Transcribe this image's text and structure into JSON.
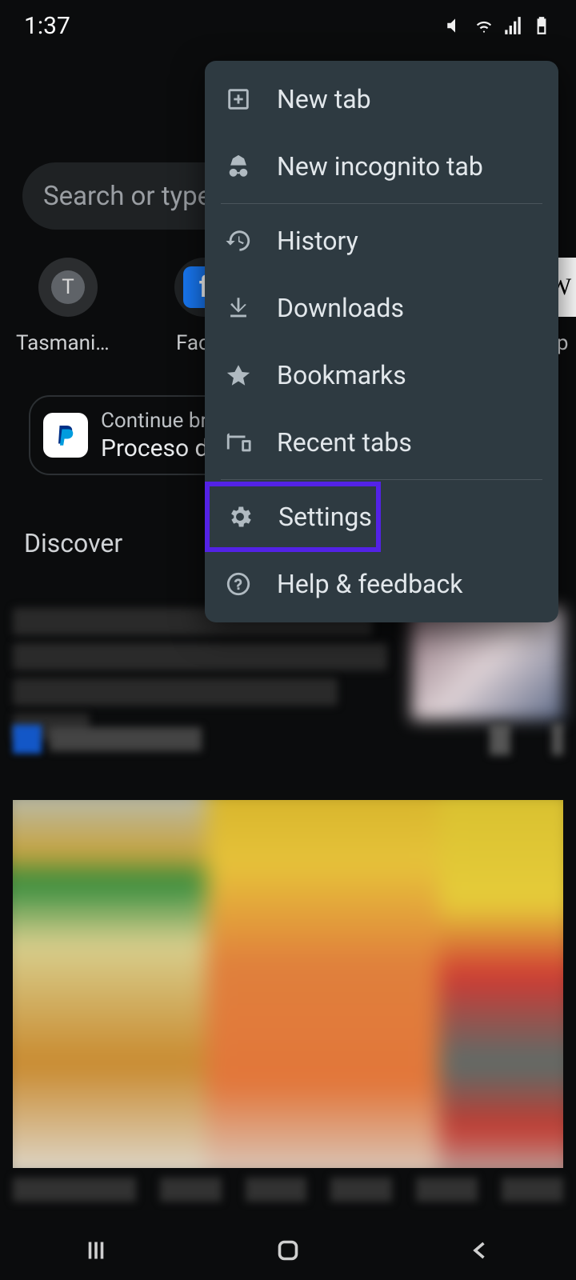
{
  "status": {
    "time": "1:37"
  },
  "search": {
    "placeholder": "Search or type web address"
  },
  "shortcuts": [
    {
      "label": "Tasmania…",
      "glyph": "T",
      "bg": "#5f6368"
    },
    {
      "label": "Faceb",
      "glyph": "f",
      "bg": "#1877f2"
    },
    {
      "label": "ip",
      "glyph": "W",
      "bg": "#ffffff"
    }
  ],
  "continue": {
    "line1": "Continue browsing",
    "line2": "Proceso de "
  },
  "discover": {
    "heading": "Discover"
  },
  "menu": {
    "items": [
      {
        "id": "new-tab",
        "label": "New tab",
        "icon": "plus-box-icon"
      },
      {
        "id": "incognito",
        "label": "New incognito tab",
        "icon": "incognito-icon"
      },
      {
        "sep": true
      },
      {
        "id": "history",
        "label": "History",
        "icon": "history-icon"
      },
      {
        "id": "downloads",
        "label": "Downloads",
        "icon": "download-icon"
      },
      {
        "id": "bookmarks",
        "label": "Bookmarks",
        "icon": "star-icon"
      },
      {
        "id": "recent-tabs",
        "label": "Recent tabs",
        "icon": "devices-icon"
      },
      {
        "sep": true
      },
      {
        "id": "settings",
        "label": "Settings",
        "icon": "gear-icon",
        "highlight": true
      },
      {
        "id": "help",
        "label": "Help & feedback",
        "icon": "help-icon"
      }
    ]
  }
}
